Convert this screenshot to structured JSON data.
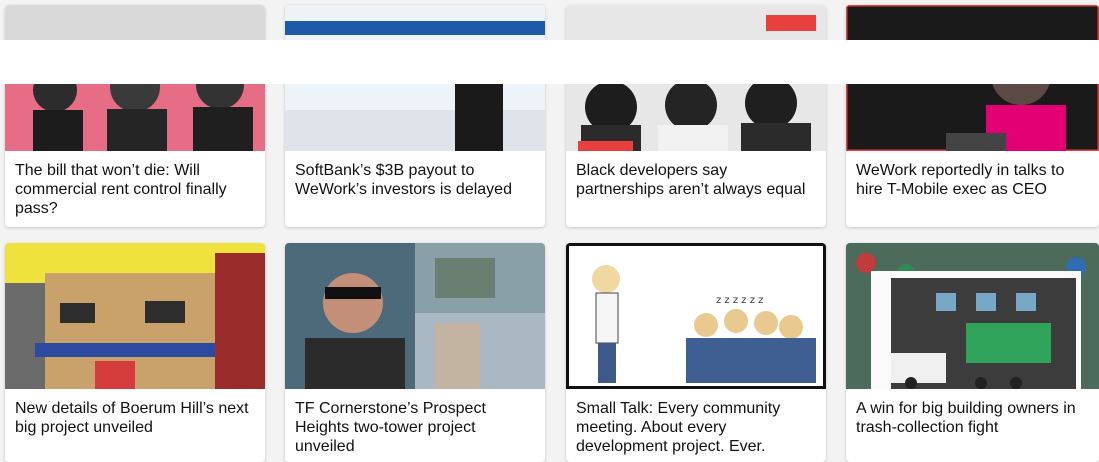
{
  "cards": [
    {
      "id": "c1",
      "title": "The bill that won’t die: Will commercial rent control finally pass?"
    },
    {
      "id": "c2",
      "title": "SoftBank’s $3B payout to WeWork’s investors is delayed"
    },
    {
      "id": "c3",
      "title": "Black developers say partnerships aren’t always equal"
    },
    {
      "id": "c4",
      "title": "WeWork reportedly in talks to hire T-Mobile exec as CEO"
    },
    {
      "id": "c5",
      "title": "New details of Boerum Hill’s next big project unveiled"
    },
    {
      "id": "c6",
      "title": "TF Cornerstone’s Prospect Heights two-tower project unveiled"
    },
    {
      "id": "c7",
      "title": "Small Talk: Every community meeting. About every development project. Ever."
    },
    {
      "id": "c8",
      "title": "A win for big building owners in trash-collection fight"
    }
  ],
  "colors": {
    "accent_red": "#e8403f",
    "pink_overlay": "#e76d86",
    "tmobile_magenta": "#e20074"
  }
}
